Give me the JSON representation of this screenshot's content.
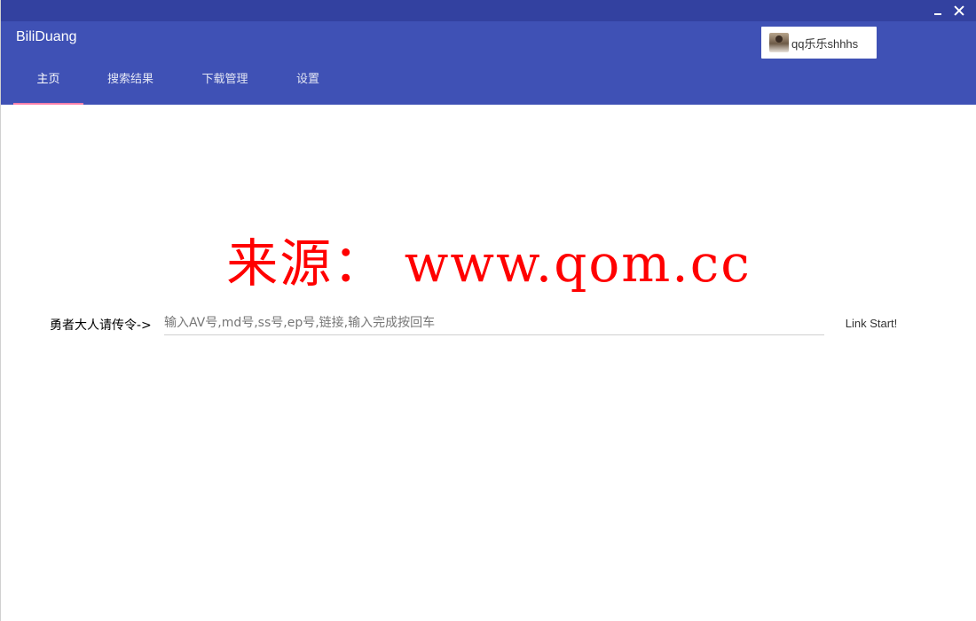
{
  "app": {
    "title": "BiliDuang"
  },
  "window_controls": {
    "minimize_icon": "minimize-icon",
    "close_icon": "close-icon"
  },
  "user": {
    "name": "qq乐乐shhhs",
    "avatar_icon": "avatar-image"
  },
  "tabs": [
    {
      "label": "主页",
      "active": true
    },
    {
      "label": "搜索结果",
      "active": false
    },
    {
      "label": "下载管理",
      "active": false
    },
    {
      "label": "设置",
      "active": false
    }
  ],
  "watermark": {
    "text": "来源： www.qom.cc"
  },
  "command": {
    "label": "勇者大人请传令->",
    "input_value": "",
    "input_placeholder": "输入AV号,md号,ss号,ep号,链接,输入完成按回车",
    "submit_label": "Link Start!"
  },
  "colors": {
    "header": "#3f51b5",
    "system_bar": "#3341a0",
    "tab_indicator": "#ff80ab",
    "watermark": "#ff0000"
  }
}
